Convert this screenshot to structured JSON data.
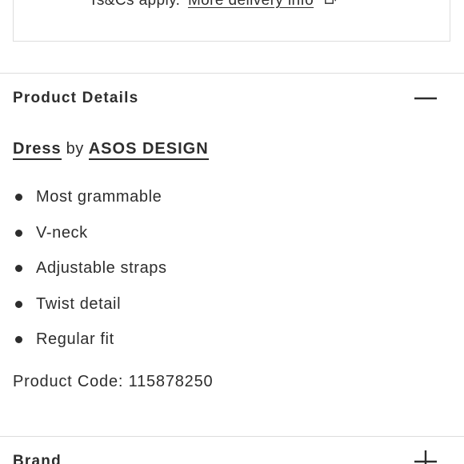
{
  "delivery": {
    "text": "Ts&Cs apply.",
    "link_label": "More delivery info",
    "icon": "external-link-icon"
  },
  "product_details": {
    "title": "Product Details",
    "toggle_icon": "minus-icon",
    "category_link": "Dress",
    "by_text": "by",
    "brand_link": "ASOS DESIGN",
    "features": [
      "Most grammable",
      "V-neck",
      "Adjustable straps",
      "Twist detail",
      "Regular fit"
    ],
    "product_code_label": "Product Code:",
    "product_code": "115878250"
  },
  "brand_section": {
    "title": "Brand",
    "toggle_icon": "plus-icon"
  }
}
